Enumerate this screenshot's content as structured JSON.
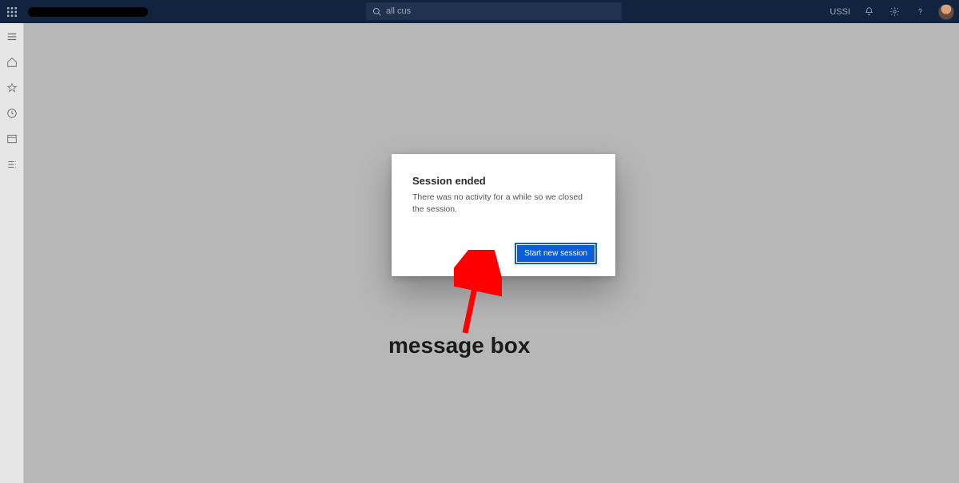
{
  "topbar": {
    "search_text": "all cus",
    "org_label": "USSI"
  },
  "modal": {
    "title": "Session ended",
    "body": "There was no activity for a while so we closed the session.",
    "primary_button": "Start new session"
  },
  "annotation": {
    "label": "message box"
  }
}
